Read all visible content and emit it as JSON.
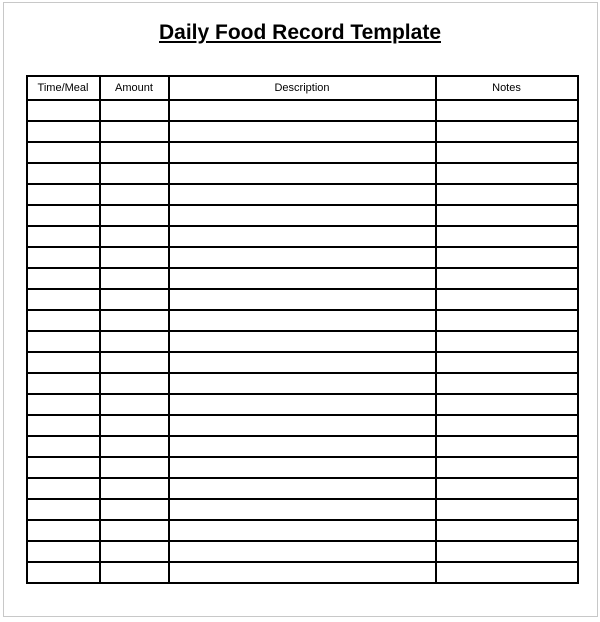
{
  "title": "Daily Food Record Template",
  "columns": {
    "time_meal": "Time/Meal",
    "amount": "Amount",
    "description": "Description",
    "notes": "Notes"
  },
  "row_count": 23
}
